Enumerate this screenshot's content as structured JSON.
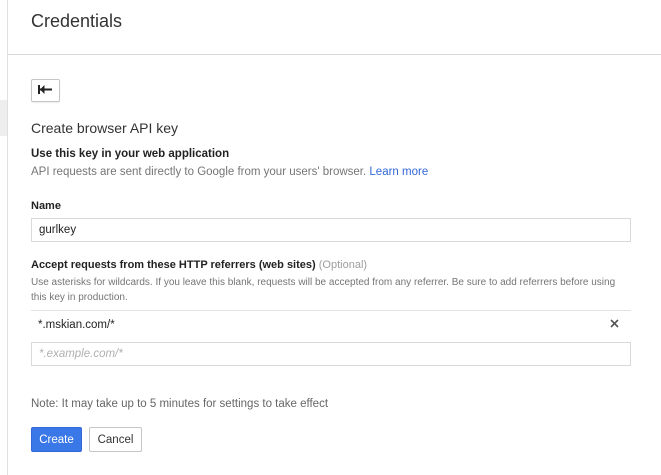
{
  "header": {
    "title": "Credentials"
  },
  "back_button": {
    "icon": "arrow-back-icon"
  },
  "form": {
    "heading": "Create browser API key",
    "usage": {
      "title": "Use this key in your web application",
      "description": "API requests are sent directly to Google from your users' browser.",
      "learn_more": "Learn more"
    },
    "name": {
      "label": "Name",
      "value": "gurlkey"
    },
    "referrers": {
      "label": "Accept requests from these HTTP referrers (web sites)",
      "optional": "(Optional)",
      "help": "Use asterisks for wildcards. If you leave this blank, requests will be accepted from any referrer. Be sure to add referrers before using this key in production.",
      "items": [
        {
          "value": "*.mskian.com/*",
          "remove_icon": "close-icon"
        }
      ],
      "placeholder": "*.example.com/*"
    },
    "note": "Note: It may take up to 5 minutes for settings to take effect",
    "create_label": "Create",
    "cancel_label": "Cancel"
  },
  "colors": {
    "primary": "#3b78e7",
    "link": "#3367d6",
    "muted_text": "#757575",
    "border": "#d9d9d9"
  }
}
